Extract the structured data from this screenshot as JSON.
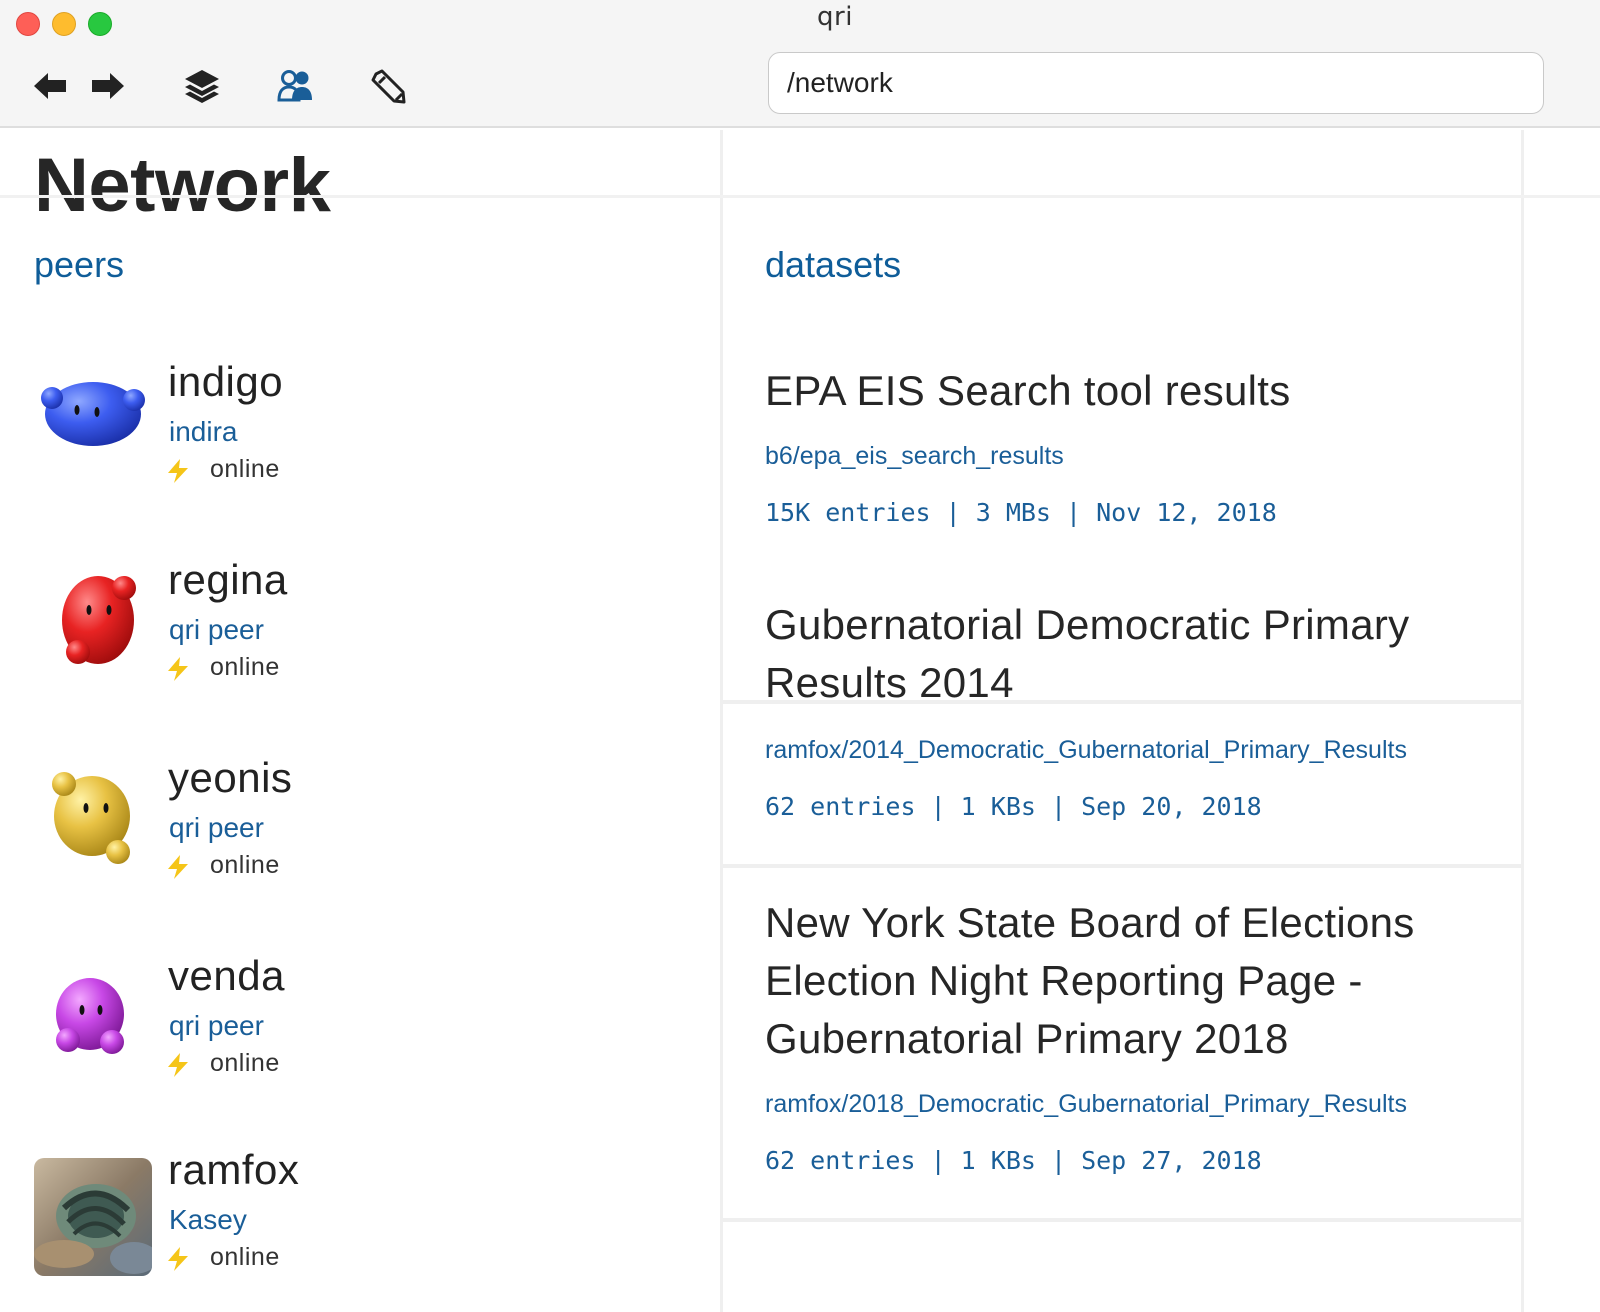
{
  "window": {
    "title": "qri"
  },
  "toolbar": {
    "icons": [
      "back-arrow-icon",
      "forward-arrow-icon",
      "layers-icon",
      "users-icon",
      "pencil-icon"
    ],
    "address_value": "/network"
  },
  "page": {
    "title": "Network"
  },
  "tabs": {
    "peers": "peers",
    "datasets": "datasets"
  },
  "colors": {
    "accent": "#0f5d99",
    "online": "#f5c518"
  },
  "peers": [
    {
      "name": "indigo",
      "handle": "indira",
      "status": "online",
      "avatar": "blue-blob"
    },
    {
      "name": "regina",
      "handle": "qri peer",
      "status": "online",
      "avatar": "red-blob"
    },
    {
      "name": "yeonis",
      "handle": "qri peer",
      "status": "online",
      "avatar": "yellow-blob"
    },
    {
      "name": "venda",
      "handle": "qri peer",
      "status": "online",
      "avatar": "purple-blob"
    },
    {
      "name": "ramfox",
      "handle": "Kasey",
      "status": "online",
      "avatar": "photo"
    }
  ],
  "datasets": [
    {
      "title": "EPA EIS Search tool results",
      "path": "b6/epa_eis_search_results",
      "meta": "15K entries | 3 MBs | Nov 12, 2018"
    },
    {
      "title": "Gubernatorial Democratic Primary Results 2014",
      "path": "ramfox/2014_Democratic_Gubernatorial_Primary_Results",
      "meta": "62 entries | 1 KBs | Sep 20, 2018"
    },
    {
      "title": "New York State Board of Elections Election Night Reporting Page - Gubernatorial Primary 2018",
      "path": "ramfox/2018_Democratic_Gubernatorial_Primary_Results",
      "meta": "62 entries | 1 KBs | Sep 27, 2018"
    }
  ]
}
